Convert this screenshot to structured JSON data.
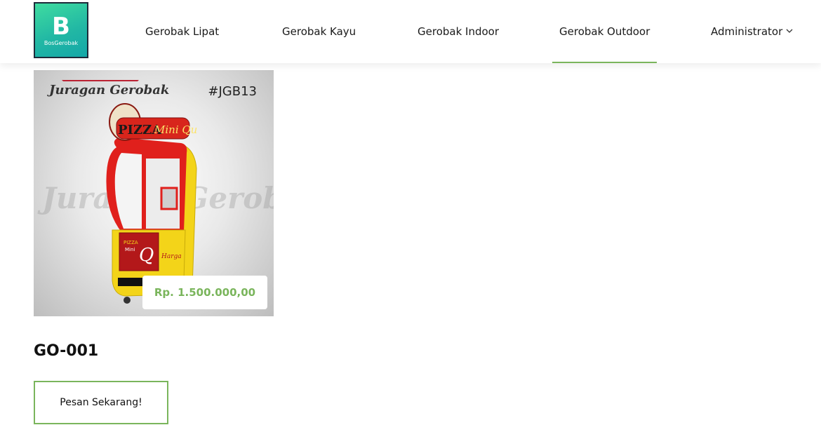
{
  "logo": {
    "letter": "B",
    "text": "BosGerobak"
  },
  "nav": {
    "items": [
      {
        "label": "Gerobak Lipat"
      },
      {
        "label": "Gerobak Kayu"
      },
      {
        "label": "Gerobak Indoor"
      },
      {
        "label": "Gerobak Outdoor",
        "active": true
      },
      {
        "label": "Administrator",
        "dropdown": true
      }
    ]
  },
  "product": {
    "image": {
      "brand": "Juragan Gerobak",
      "code_tag": "#JGB13",
      "sign_text": "PIZZA Mini Qu",
      "panel_text": "PIZZA Mini Qu",
      "panel_brand": "Q",
      "panel_sub": "Harga",
      "watermark": "Juragan Gerobak"
    },
    "price": "Rp. 1.500.000,00",
    "title": "GO-001",
    "order_button": "Pesan Sekarang!"
  },
  "colors": {
    "accent": "#7ab55c",
    "logo_gradient_start": "#3fdca0",
    "logo_gradient_end": "#14a7a8",
    "cart_red": "#e0201c",
    "cart_yellow": "#f3d419"
  },
  "icons": {
    "dropdown": "chevron-down-icon"
  }
}
